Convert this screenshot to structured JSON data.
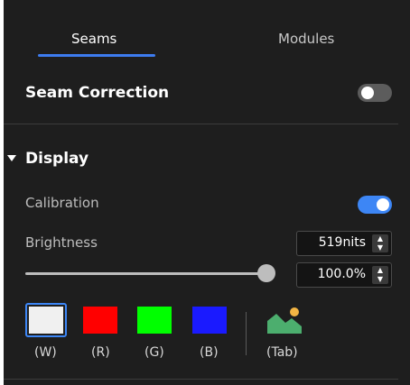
{
  "tabs": {
    "seams": "Seams",
    "modules": "Modules",
    "active": "seams"
  },
  "seam_correction": {
    "label": "Seam Correction",
    "enabled": false
  },
  "display": {
    "label": "Display",
    "expanded": true,
    "calibration": {
      "label": "Calibration",
      "enabled": true
    },
    "brightness": {
      "label": "Brightness",
      "nits_value": "519nits",
      "percent_value": "100.0%",
      "slider_fraction": 1.0
    },
    "colors": [
      {
        "label": "(W)",
        "color": "#f0f0f0",
        "selected": true
      },
      {
        "label": "(R)",
        "color": "#ff0000",
        "selected": false
      },
      {
        "label": "(G)",
        "color": "#00ff00",
        "selected": false
      },
      {
        "label": "(B)",
        "color": "#1a1aff",
        "selected": false
      }
    ],
    "image_mode": {
      "label": "(Tab)",
      "icon": "image-icon"
    }
  },
  "accent_color": "#3d86f5"
}
